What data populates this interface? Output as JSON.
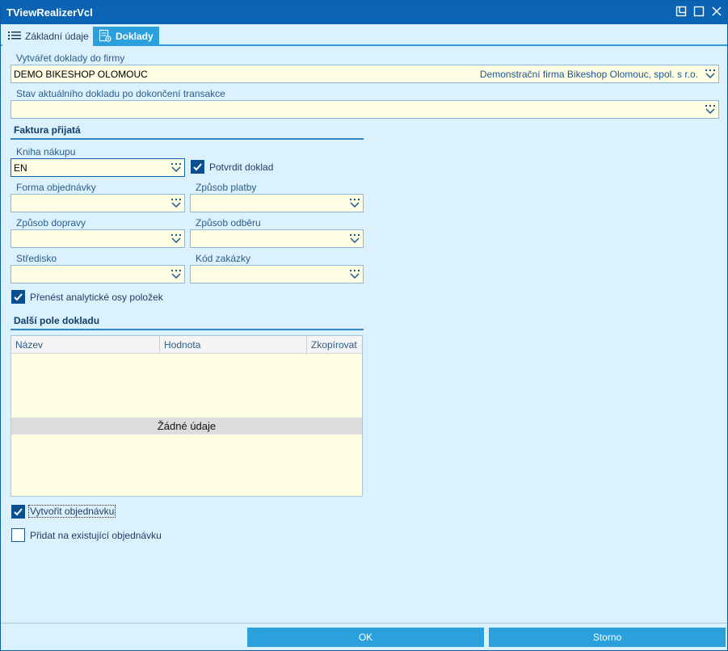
{
  "window": {
    "title": "TViewRealizerVcl"
  },
  "tabs": [
    {
      "label": "Základní údaje",
      "icon": "list-icon",
      "active": false
    },
    {
      "label": "Doklady",
      "icon": "document-settings-icon",
      "active": true
    }
  ],
  "firma": {
    "label": "Vytvářet doklady do firmy",
    "value": "DEMO BIKESHOP OLOMOUC",
    "hint": "Demonstrační firma Bikeshop Olomouc, spol. s r.o."
  },
  "stav": {
    "label": "Stav aktuálního dokladu po dokončení transakce",
    "value": ""
  },
  "faktura": {
    "title": "Faktura přijatá",
    "kniha_label": "Kniha nákupu",
    "kniha_value": "EN",
    "potvrdit_label": "Potvrdit doklad",
    "potvrdit_checked": true,
    "forma_label": "Forma objednávky",
    "zpusob_platby_label": "Způsob platby",
    "zpusob_dopravy_label": "Způsob dopravy",
    "zpusob_odberu_label": "Způsob odběru",
    "stredisko_label": "Středisko",
    "kod_zakazky_label": "Kód zakázky",
    "prenest_label": "Přenést analytické osy položek",
    "prenest_checked": true
  },
  "dalsi": {
    "title": "Další pole dokladu",
    "columns": [
      "Název",
      "Hodnota",
      "Zkopírovat"
    ],
    "empty_text": "Žádné údaje"
  },
  "vytvorit": {
    "label": "Vytvořit objednávku",
    "checked": true
  },
  "pridat": {
    "label": "Přidat na existující objednávku",
    "checked": false
  },
  "buttons": {
    "ok": "OK",
    "storno": "Storno"
  },
  "colors": {
    "title_bar": "#0a63b3",
    "tab_active": "#2aa0dd",
    "background": "#dbf1fd",
    "field_bg": "#fefee2"
  }
}
